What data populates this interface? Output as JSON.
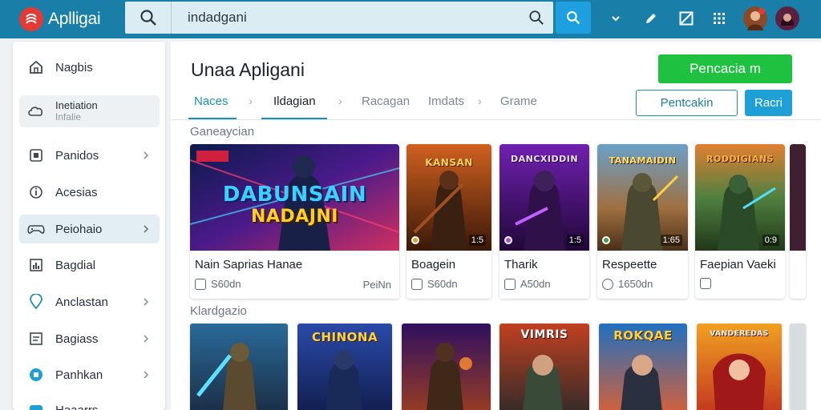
{
  "app": {
    "name": "Aplligai"
  },
  "colors": {
    "topbar": "#1a7fa8",
    "accent": "#1e9fe0",
    "primary": "#1fc140",
    "logo": "#e53935"
  },
  "search": {
    "value": "indadgani"
  },
  "sidebar": {
    "items": [
      {
        "label": "Nagbis",
        "icon": "home-icon"
      },
      {
        "label1": "Inetiation",
        "label2": "Infalie",
        "icon": "cloud-icon"
      },
      {
        "label": "Panidos",
        "icon": "box-icon"
      },
      {
        "label": "Acesias",
        "icon": "info-icon"
      },
      {
        "label": "Peiohaio",
        "icon": "gamepad-icon"
      },
      {
        "label": "Bagdial",
        "icon": "chart-icon"
      },
      {
        "label": "Anclastan",
        "icon": "location-icon"
      },
      {
        "label": "Bagiass",
        "icon": "list-icon"
      },
      {
        "label": "Panhkan",
        "icon": "badge-icon"
      },
      {
        "label": "Haaarrs",
        "icon": "extra-icon"
      }
    ]
  },
  "main": {
    "title": "Unaa Apligani",
    "primary_button": "Pencacia m",
    "tabs": [
      "Naces",
      "Ildagian",
      "Racagan",
      "Imdats",
      "Grame"
    ],
    "outline_button": "Pentcakin",
    "fill_button": "Racri",
    "section1": "Ganeaycian",
    "section2": "Klardgazio"
  },
  "cards": [
    {
      "name": "Nain Saprias Hanae",
      "meta": "S60dn",
      "right": "PeiNn",
      "art_title_1": "DABUNSAIN",
      "art_title_2": "NADAJNI",
      "badge": "",
      "dot": ""
    },
    {
      "name": "Boagein",
      "meta": "S60dn",
      "right": "",
      "art_title_1": "KANSAN",
      "badge": "1:5",
      "dot": "#e0a030"
    },
    {
      "name": "Tharik",
      "meta": "A50dn",
      "right": "",
      "art_title_1": "DANCXIDDIN",
      "badge": "1:5",
      "dot": "#b048e0"
    },
    {
      "name": "Respeette",
      "meta": "1650dn",
      "right": "",
      "art_title_1": "TANAMAIDIN",
      "badge": "1:65",
      "dot": "#40a050"
    },
    {
      "name": "Faepian Vaeki",
      "meta": "",
      "right": "",
      "art_title_1": "RODDIGIANS",
      "badge": "0:9",
      "dot": ""
    }
  ],
  "tiles": [
    {
      "art_title": ""
    },
    {
      "art_title": "CHINONA"
    },
    {
      "art_title": ""
    },
    {
      "art_title": "VIMRIS"
    },
    {
      "art_title": "ROKQAE"
    },
    {
      "art_title": "VANDEREDAS"
    }
  ]
}
